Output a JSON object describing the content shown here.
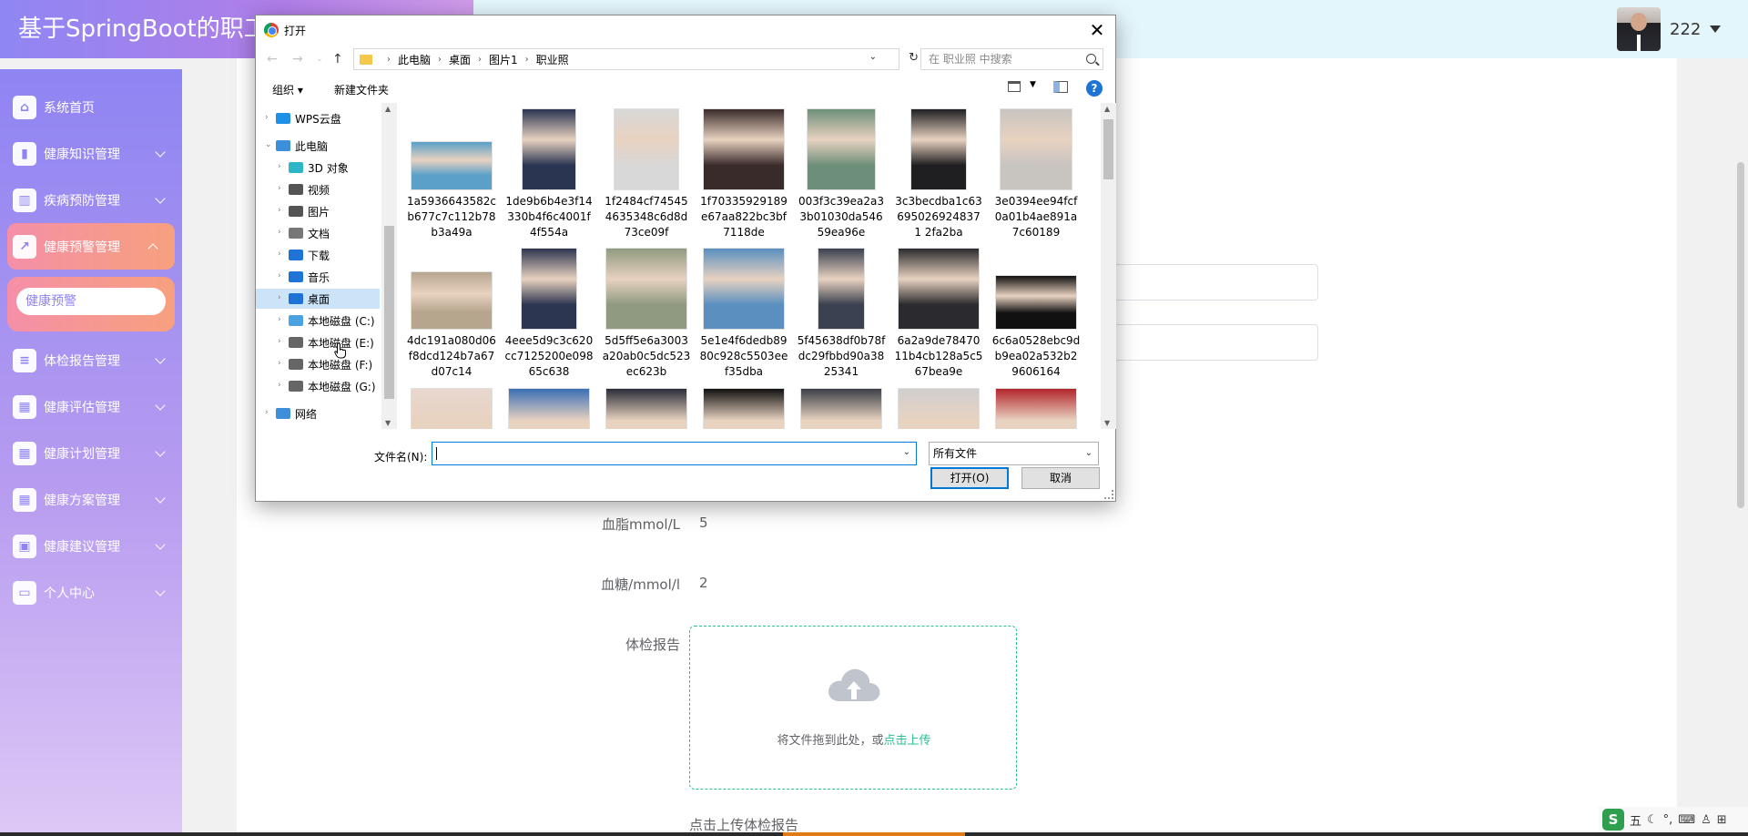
{
  "app": {
    "title": "基于SpringBoot的职工健康管理系统",
    "username": "222"
  },
  "sidebar": {
    "items": [
      {
        "label": "系统首页",
        "icon": "home-icon",
        "has_arrow": false
      },
      {
        "label": "健康知识管理",
        "icon": "book-icon",
        "has_arrow": true
      },
      {
        "label": "疾病预防管理",
        "icon": "library-icon",
        "has_arrow": true
      },
      {
        "label": "健康预警管理",
        "icon": "chart-icon",
        "has_arrow": true,
        "active": true
      },
      {
        "label": "体检报告管理",
        "icon": "sliders-icon",
        "has_arrow": true
      },
      {
        "label": "健康评估管理",
        "icon": "grid-icon",
        "has_arrow": true
      },
      {
        "label": "健康计划管理",
        "icon": "grid-icon",
        "has_arrow": true
      },
      {
        "label": "健康方案管理",
        "icon": "grid-icon",
        "has_arrow": true
      },
      {
        "label": "健康建议管理",
        "icon": "briefcase-icon",
        "has_arrow": true
      },
      {
        "label": "个人中心",
        "icon": "card-icon",
        "has_arrow": true
      }
    ],
    "submenu": {
      "label": "健康预警"
    }
  },
  "form": {
    "blood_lipid_label": "血脂mmol/L",
    "blood_lipid_value": "5",
    "blood_sugar_label": "血糖/mmol/l",
    "blood_sugar_value": "2",
    "report_label": "体检报告",
    "upload_text": "将文件拖到此处，或",
    "upload_link": "点击上传",
    "upload_hint": "点击上传体检报告"
  },
  "dialog": {
    "title": "打开",
    "breadcrumb": [
      "此电脑",
      "桌面",
      "图片1",
      "职业照"
    ],
    "search_placeholder": "在 职业照 中搜索",
    "toolbar": {
      "organize": "组织 ▾",
      "new_folder": "新建文件夹"
    },
    "tree": [
      {
        "label": "WPS云盘",
        "icon_color": "#1e90e8"
      },
      {
        "label": "此电脑",
        "icon_color": "#3c8fd8"
      },
      {
        "label": "3D 对象",
        "icon_color": "#2fb5c9"
      },
      {
        "label": "视频",
        "icon_color": "#555555"
      },
      {
        "label": "图片",
        "icon_color": "#555555"
      },
      {
        "label": "文档",
        "icon_color": "#777777"
      },
      {
        "label": "下载",
        "icon_color": "#1e73d6"
      },
      {
        "label": "音乐",
        "icon_color": "#1e73d6"
      },
      {
        "label": "桌面",
        "icon_color": "#1e73d6",
        "selected": true
      },
      {
        "label": "本地磁盘 (C:)",
        "icon_color": "#4aa3df"
      },
      {
        "label": "本地磁盘 (E:)",
        "icon_color": "#666666"
      },
      {
        "label": "本地磁盘 (F:)",
        "icon_color": "#666666"
      },
      {
        "label": "本地磁盘 (G:)",
        "icon_color": "#666666"
      },
      {
        "label": "网络",
        "icon_color": "#3c8fd8"
      }
    ],
    "files": [
      {
        "name": "1a5936643582cb677c7c112b78b3a49a",
        "bg": "#5aa0c8"
      },
      {
        "name": "1de9b6b4e3f14330b4f6c4001f4f554a",
        "bg": "#2a3552"
      },
      {
        "name": "1f2484cf745454635348c6d8d73ce09f",
        "bg": "#d8d8d8"
      },
      {
        "name": "1f70335929189e67aa822bc3bf7118de",
        "bg": "#3a2b2b"
      },
      {
        "name": "003f3c39ea2a33b01030da54659ea96e",
        "bg": "#6d8f7a"
      },
      {
        "name": "3c3becdba1c636950269248371 2fa2ba",
        "bg": "#1f1f22"
      },
      {
        "name": "3e0394ee94fcf0a01b4ae891a7c60189",
        "bg": "#c8c4c0"
      },
      {
        "name": "4dc191a080d06f8dcd124b7a67d07c14",
        "bg": "#b7a68e"
      },
      {
        "name": "4eee5d9c3c620cc7125200e09865c638",
        "bg": "#2d3650"
      },
      {
        "name": "5d5ff5e6a3003a20ab0c5dc523ec623b",
        "bg": "#8f9a80"
      },
      {
        "name": "5e1e4f6dedb8980c928c5503eef35dba",
        "bg": "#5a8fc0"
      },
      {
        "name": "5f45638df0b78fdc29fbbd90a3825341",
        "bg": "#3b4150"
      },
      {
        "name": "6a2a9de7847011b4cb128a5c567bea9e",
        "bg": "#2b2b2f"
      },
      {
        "name": "6c6a0528ebc9db9ea02a532b29606164",
        "bg": "#111111"
      }
    ],
    "filename_label": "文件名(N):",
    "filename_value": "",
    "filetype": "所有文件",
    "open_button": "打开(O)",
    "cancel_button": "取消"
  },
  "ime": {
    "label": "五"
  }
}
